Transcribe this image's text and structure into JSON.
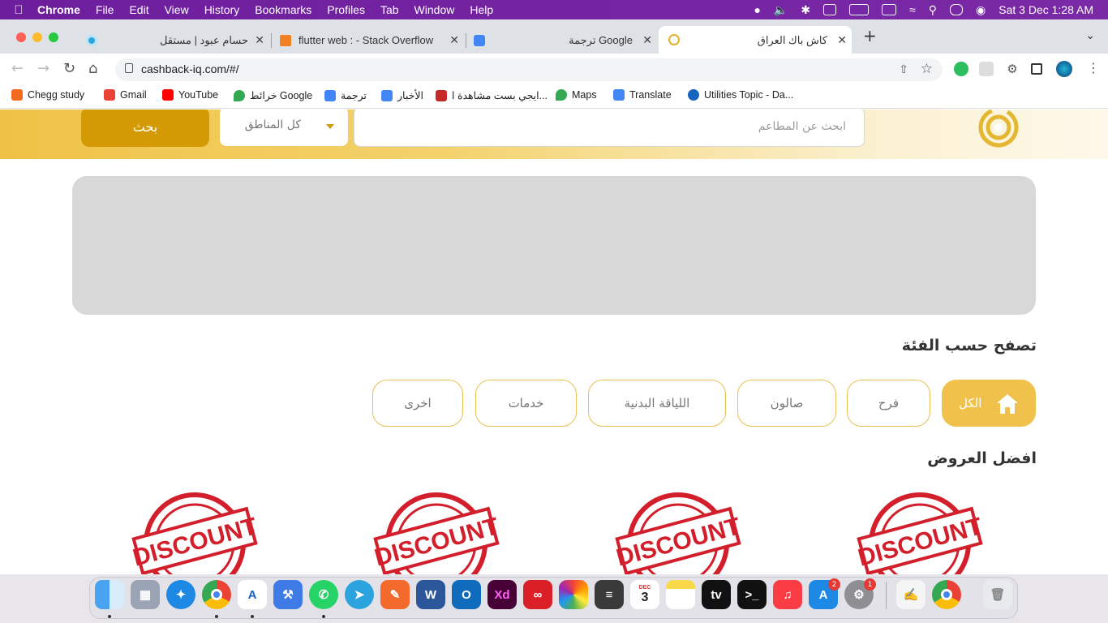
{
  "menubar": {
    "app": "Chrome",
    "items": [
      "File",
      "Edit",
      "View",
      "History",
      "Bookmarks",
      "Profiles",
      "Tab",
      "Window",
      "Help"
    ],
    "datetime": "Sat 3 Dec  1:28 AM"
  },
  "tabs": [
    {
      "title": "حسام عبود | مستقل"
    },
    {
      "title": "flutter web : - Stack Overflow"
    },
    {
      "title": "ترجمة Google"
    },
    {
      "title": "كاش باك العراق"
    }
  ],
  "omnibox": {
    "url": "cashback-iq.com/#/"
  },
  "bookmarks": [
    {
      "label": "Chegg study",
      "color": "#f26b21"
    },
    {
      "label": "Gmail",
      "color": "#ea4335"
    },
    {
      "label": "YouTube",
      "color": "#ff0000"
    },
    {
      "label": "خرائط Google",
      "color": "#34a853"
    },
    {
      "label": "ترجمة",
      "color": "#4285f4"
    },
    {
      "label": "الأخبار",
      "color": "#4285f4"
    },
    {
      "label": "ايجي بست مشاهدة ا...",
      "color": "#c62828"
    },
    {
      "label": "Maps",
      "color": "#34a853"
    },
    {
      "label": "Translate",
      "color": "#4285f4"
    },
    {
      "label": "Utilities Topic - Da...",
      "color": "#1565c0"
    }
  ],
  "header": {
    "search_button": "بحث",
    "region_select": "كل المناطق",
    "search_placeholder": "ابحث عن المطاعم"
  },
  "categories": {
    "heading": "تصفح حسب الفئة",
    "items": [
      "الكل",
      "فرح",
      "صالون",
      "اللياقة البدنية",
      "خدمات",
      "اخرى"
    ]
  },
  "offers": {
    "heading": "افضل العروض",
    "stamp_text": "DISCOUNT"
  },
  "dock": {
    "calendar_month": "DEC",
    "calendar_day": "3",
    "appstore_badge": "2",
    "settings_badge": "1",
    "word_label": "W",
    "outlook_label": "O",
    "xd_label": "Xd",
    "tv_label": "tv"
  },
  "colors": {
    "brand": "#d49a06",
    "chip_active": "#f0c24b",
    "menubar": "#6d1e9c"
  }
}
